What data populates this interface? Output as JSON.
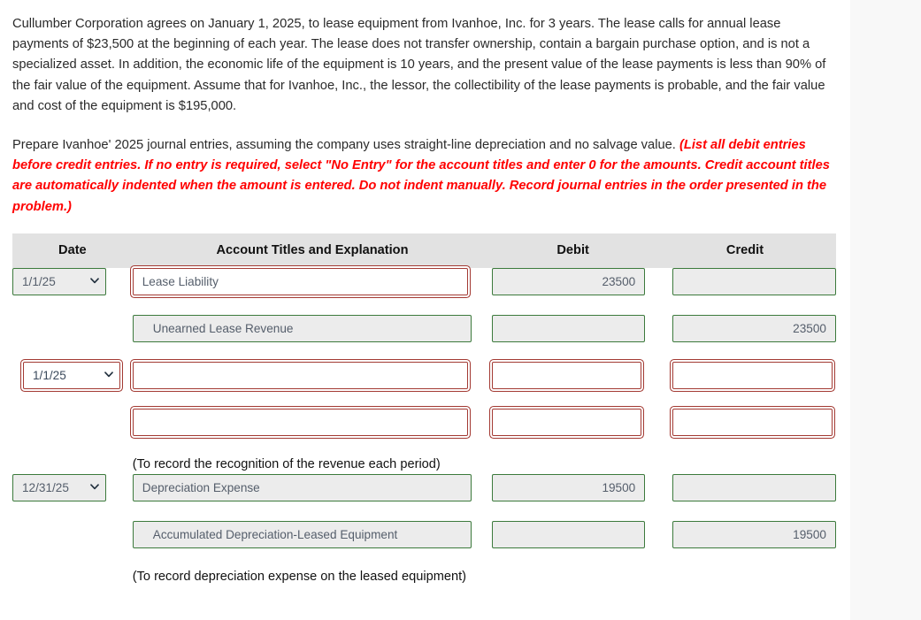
{
  "problem": {
    "paragraph_1": "Cullumber Corporation agrees on January 1, 2025, to lease equipment from Ivanhoe, Inc. for 3 years. The lease calls for annual lease payments of $23,500 at the beginning of each year. The lease does not transfer ownership, contain a bargain purchase option, and is not a specialized asset. In addition, the economic life of the equipment is 10 years, and the present value of the lease payments is less than 90% of the fair value of the equipment. Assume that for Ivanhoe, Inc., the lessor, the collectibility of the lease payments is probable, and the fair value and cost of the equipment is $195,000.",
    "paragraph_2_lead": "Prepare Ivanhoe' 2025 journal entries, assuming the company uses straight-line depreciation and no salvage value. ",
    "paragraph_2_instruction": "(List all debit entries before credit entries. If no entry is required, select \"No Entry\" for the account titles and enter 0 for the amounts. Credit account titles are automatically indented when the amount is entered. Do not indent manually. Record journal entries in the order presented in the problem.)",
    "instruction_color": "#ff0000"
  },
  "table": {
    "headers": {
      "date": "Date",
      "account": "Account Titles and Explanation",
      "debit": "Debit",
      "credit": "Credit"
    },
    "date_options": [
      "1/1/25",
      "12/31/25"
    ],
    "entries": [
      {
        "date_value": "1/1/25",
        "date_error": false,
        "lines": [
          {
            "account": "Lease Liability",
            "account_error": true,
            "indented": false,
            "debit": "23500",
            "debit_error": false,
            "credit": "",
            "credit_error": false
          },
          {
            "account": "Unearned Lease Revenue",
            "account_error": false,
            "indented": true,
            "debit": "",
            "debit_error": false,
            "credit": "23500",
            "credit_error": false
          }
        ],
        "memo": ""
      },
      {
        "date_value": "1/1/25",
        "date_error": true,
        "lines": [
          {
            "account": "",
            "account_error": true,
            "indented": false,
            "debit": "",
            "debit_error": true,
            "credit": "",
            "credit_error": true
          },
          {
            "account": "",
            "account_error": true,
            "indented": false,
            "debit": "",
            "debit_error": true,
            "credit": "",
            "credit_error": true
          }
        ],
        "memo": "(To record the recognition of the revenue each period)"
      },
      {
        "date_value": "12/31/25",
        "date_error": false,
        "lines": [
          {
            "account": "Depreciation Expense",
            "account_error": false,
            "indented": false,
            "debit": "19500",
            "debit_error": false,
            "credit": "",
            "credit_error": false
          },
          {
            "account": "Accumulated Depreciation-Leased Equipment",
            "account_error": false,
            "indented": true,
            "debit": "",
            "debit_error": false,
            "credit": "19500",
            "credit_error": false
          }
        ],
        "memo": "(To record depreciation expense on the leased equipment)"
      }
    ]
  },
  "colors": {
    "valid_border": "#3c7a3c",
    "error_border": "#a33a33",
    "field_background": "#ececec",
    "header_background": "#e2e2e2"
  }
}
